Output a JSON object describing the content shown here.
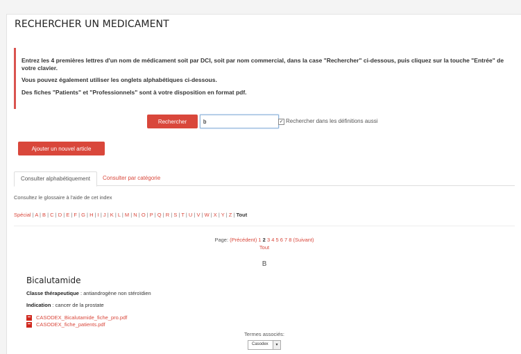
{
  "page": {
    "title": "RECHERCHER UN MEDICAMENT"
  },
  "notice": {
    "line1": "Entrez les 4 premières lettres d'un nom de médicament soit par DCI, soit par nom commercial, dans la case \"Rechercher\" ci-dessous, puis cliquez sur la touche \"Entrée\" de votre clavier.",
    "line2": "Vous pouvez également utiliser les onglets alphabétiques ci-dessous.",
    "line3": "Des fiches \"Patients\" et \"Professionnels\" sont à votre disposition en format pdf."
  },
  "search": {
    "button_label": "Rechercher",
    "input_value": "b",
    "checkbox_checked": true,
    "checkbox_mark": "✓",
    "checkbox_label": "Rechercher dans les définitions aussi"
  },
  "add_button_label": "Ajouter un nouvel article",
  "tabs": [
    {
      "label": "Consulter alphabétiquement",
      "active": true
    },
    {
      "label": "Consulter par catégorie",
      "active": false
    }
  ],
  "glossary_text": "Consultez le glossaire à l'aide de cet index",
  "alphabet": {
    "items": [
      "Spécial",
      "A",
      "B",
      "C",
      "D",
      "E",
      "F",
      "G",
      "H",
      "I",
      "J",
      "K",
      "L",
      "M",
      "N",
      "O",
      "P",
      "Q",
      "R",
      "S",
      "T",
      "U",
      "V",
      "W",
      "X",
      "Y",
      "Z"
    ],
    "current": "Tout"
  },
  "pager": {
    "prefix": "Page:",
    "prev_label": "(Précédent)",
    "pages": [
      "1",
      "2",
      "3",
      "4",
      "5",
      "6",
      "7",
      "8"
    ],
    "current_page": "2",
    "next_label": "(Suivant)",
    "all_label": "Tout"
  },
  "section_letter": "B",
  "entry": {
    "title": "Bicalutamide",
    "class_label": "Classe thérapeutique",
    "class_value": " : antiandrogène non stéroïdien",
    "indication_label": "Indication",
    "indication_value": " : cancer de la prostate",
    "files": [
      "CASODEX_Bicalutamide_fiche_pro.pdf",
      "CASODEX_fiche_patients.pdf"
    ],
    "associated_label": "Termes associés:",
    "associated_selected": "Casodex"
  },
  "colors": {
    "accent": "#d9473b",
    "pdf_icon": "#d0281e"
  }
}
